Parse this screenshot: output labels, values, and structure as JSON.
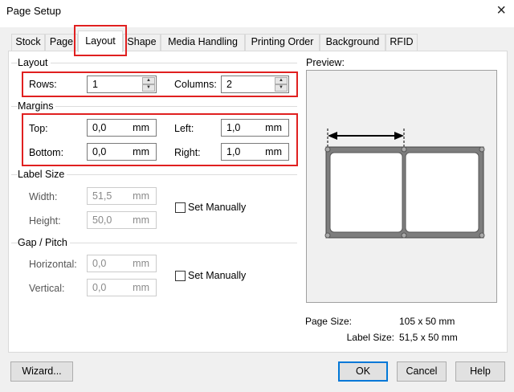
{
  "window": {
    "title": "Page Setup",
    "close_icon": "×"
  },
  "tabs": [
    {
      "label": "Stock"
    },
    {
      "label": "Page"
    },
    {
      "label": "Layout"
    },
    {
      "label": "Shape"
    },
    {
      "label": "Media Handling"
    },
    {
      "label": "Printing Order"
    },
    {
      "label": "Background"
    },
    {
      "label": "RFID"
    }
  ],
  "active_tab": "Layout",
  "layout_group": {
    "title": "Layout",
    "rows_label": "Rows:",
    "rows_value": "1",
    "columns_label": "Columns:",
    "columns_value": "2"
  },
  "margins_group": {
    "title": "Margins",
    "top_label": "Top:",
    "top_value": "0,0",
    "left_label": "Left:",
    "left_value": "1,0",
    "bottom_label": "Bottom:",
    "bottom_value": "0,0",
    "right_label": "Right:",
    "right_value": "1,0",
    "unit": "mm"
  },
  "label_size_group": {
    "title": "Label Size",
    "width_label": "Width:",
    "width_value": "51,5",
    "height_label": "Height:",
    "height_value": "50,0",
    "unit": "mm",
    "set_manually_label": "Set Manually"
  },
  "gap_group": {
    "title": "Gap / Pitch",
    "horizontal_label": "Horizontal:",
    "horizontal_value": "0,0",
    "vertical_label": "Vertical:",
    "vertical_value": "0,0",
    "unit": "mm",
    "set_manually_label": "Set Manually"
  },
  "preview": {
    "title": "Preview:",
    "page_size_label": "Page Size:",
    "page_size_value": "105 x 50 mm",
    "label_size_label": "Label Size:",
    "label_size_value": "51,5 x 50 mm"
  },
  "buttons": {
    "wizard": "Wizard...",
    "ok": "OK",
    "cancel": "Cancel",
    "help": "Help"
  },
  "colors": {
    "highlight_red": "#e02020",
    "dialog_bg": "#f0f0f0",
    "panel_bg": "#ffffff"
  }
}
